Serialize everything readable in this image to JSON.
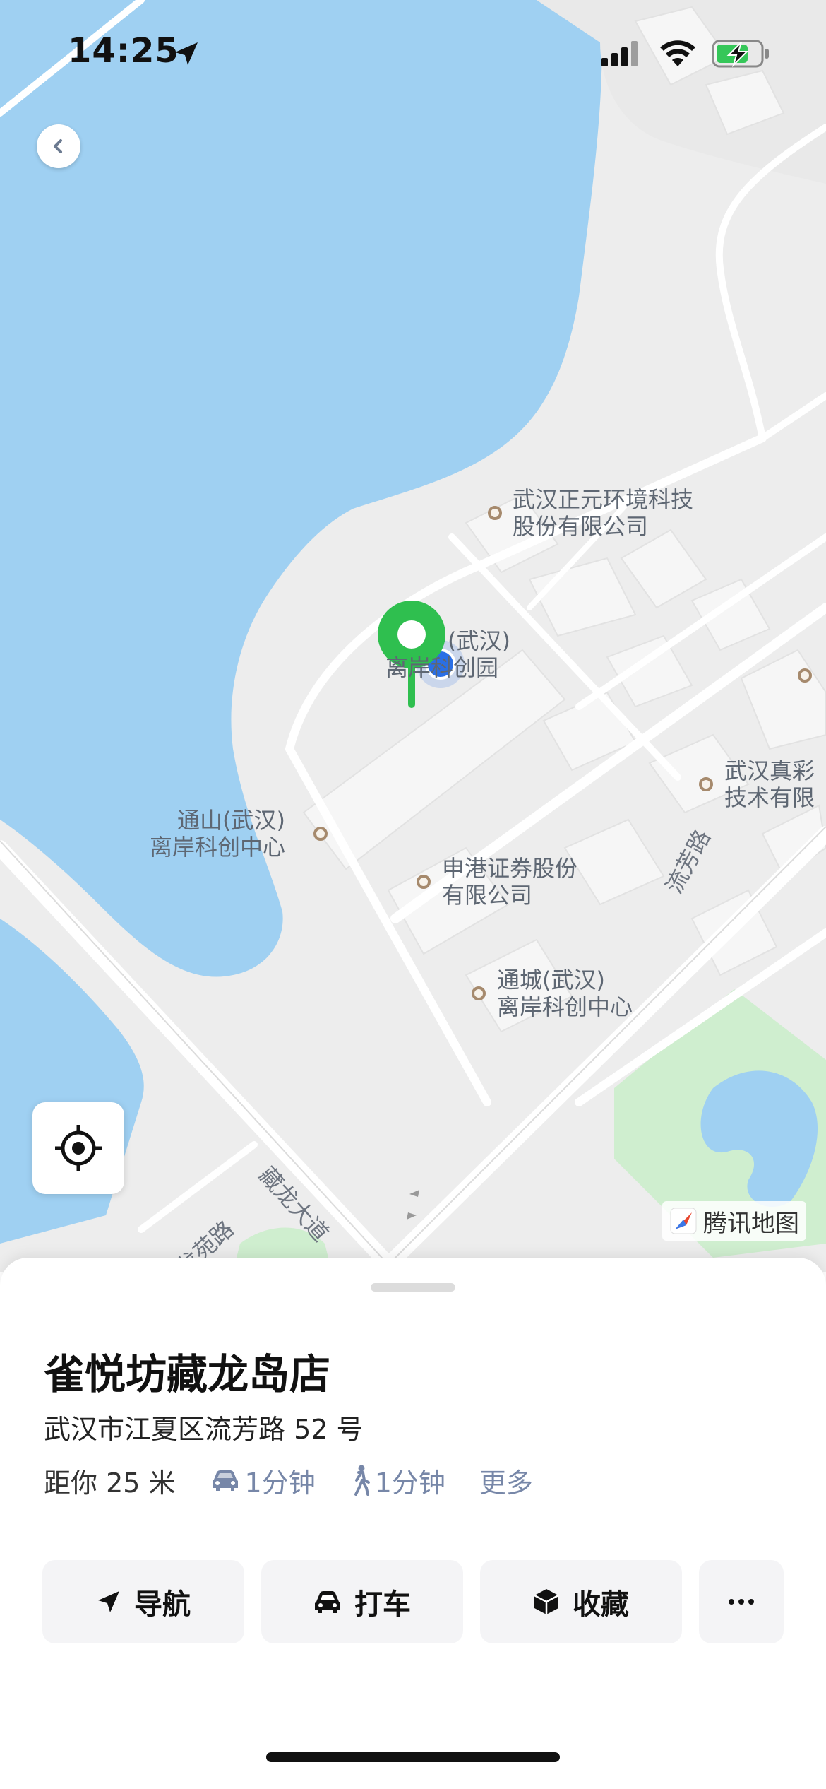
{
  "status_bar": {
    "time": "14:25"
  },
  "map": {
    "pois": [
      {
        "name": "pois-zhengyuan",
        "lines": [
          "武汉正元环境科技",
          "股份有限公司"
        ]
      },
      {
        "name": "pois-kechuangyuan",
        "lines": [
          "(武汉)",
          "离岸科创园"
        ]
      },
      {
        "name": "pois-tongshan",
        "lines": [
          "通山(武汉)",
          "离岸科创中心"
        ]
      },
      {
        "name": "pois-shengang",
        "lines": [
          "申港证券股份",
          "有限公司"
        ]
      },
      {
        "name": "pois-tongcheng",
        "lines": [
          "通城(武汉)",
          "离岸科创中心"
        ]
      },
      {
        "name": "pois-zhencai",
        "lines": [
          "武汉真彩",
          "技术有限"
        ]
      }
    ],
    "roads": {
      "liufang": "流芳路",
      "canglong": "藏龙大道",
      "longyuan": "龙苑路"
    },
    "logo_text": "腾讯地图",
    "colors": {
      "water": "#9fd0f2",
      "land": "#ededed",
      "park": "#cfeecf",
      "pin": "#2fbf4f",
      "user_dot": "#2a6fe6"
    }
  },
  "sheet": {
    "title": "雀悦坊藏龙岛店",
    "address": "武汉市江夏区流芳路 52 号",
    "distance": "距你 25 米",
    "drive_time": "1分钟",
    "walk_time": "1分钟",
    "more": "更多",
    "actions": {
      "navigate": "导航",
      "taxi": "打车",
      "favorite": "收藏",
      "more_icon": "ellipsis-icon"
    }
  }
}
